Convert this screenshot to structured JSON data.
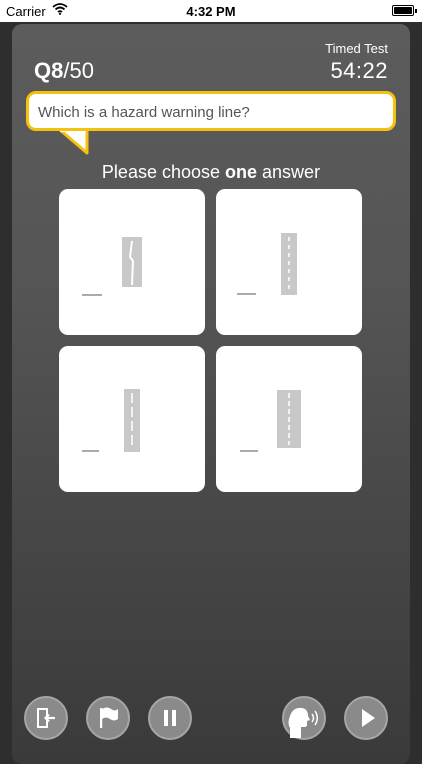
{
  "status_bar": {
    "carrier": "Carrier",
    "time": "4:32 PM"
  },
  "header": {
    "question_current": "Q8",
    "question_total": "/50",
    "timer_label": "Timed Test",
    "timer_value": "54:22"
  },
  "question": {
    "text": "Which is a hazard warning line?"
  },
  "prompt": {
    "before": "Please choose ",
    "emphasis": "one",
    "after": " answer"
  },
  "answers": [
    {
      "id": "A",
      "image": "road-marking-a"
    },
    {
      "id": "B",
      "image": "road-marking-b"
    },
    {
      "id": "C",
      "image": "road-marking-c"
    },
    {
      "id": "D",
      "image": "road-marking-d"
    }
  ],
  "controls": [
    {
      "name": "exit-icon"
    },
    {
      "name": "flag-icon"
    },
    {
      "name": "pause-icon"
    },
    {
      "name": "voice-icon"
    },
    {
      "name": "next-icon"
    }
  ],
  "colors": {
    "accent": "#f4c20d",
    "panel_top": "#5c5c5c",
    "panel_bottom": "#3a3a3a",
    "control": "#8a8a8a"
  }
}
